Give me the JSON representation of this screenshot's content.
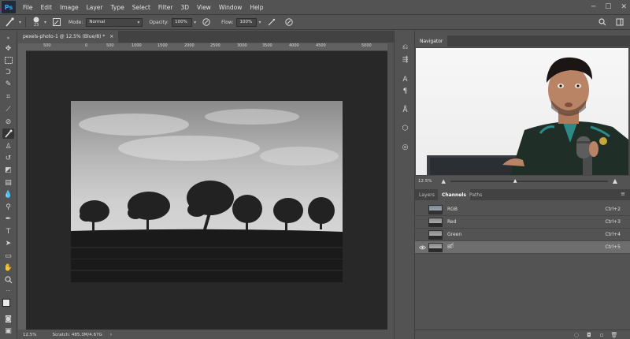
{
  "app": {
    "logo": "Ps"
  },
  "menu": [
    "File",
    "Edit",
    "Image",
    "Layer",
    "Type",
    "Select",
    "Filter",
    "3D",
    "View",
    "Window",
    "Help"
  ],
  "options": {
    "brush_size": "23",
    "mode_label": "Mode:",
    "mode_value": "Normal",
    "opacity_label": "Opacity:",
    "opacity_value": "100%",
    "flow_label": "Flow:",
    "flow_value": "100%"
  },
  "document": {
    "tab_title": "pexels-photo-1 @ 12.5% (Blue/8) *",
    "close": "×",
    "ruler_ticks": [
      "500",
      "0",
      "500",
      "1000",
      "1500",
      "2000",
      "2500",
      "3000",
      "3500",
      "4000",
      "4500",
      "5000"
    ],
    "zoom": "12.5%",
    "scratch": "Scratch: 485.3M/4.67G"
  },
  "navigator": {
    "tab": "Navigator",
    "zoom": "12.5%"
  },
  "panels": {
    "tabs": [
      "Layers",
      "Channels",
      "Paths"
    ],
    "active_tab": "Channels",
    "channels": [
      {
        "name": "RGB",
        "shortcut": "Ctrl+2",
        "visible": false
      },
      {
        "name": "Red",
        "shortcut": "Ctrl+3",
        "visible": false
      },
      {
        "name": "Green",
        "shortcut": "Ctrl+4",
        "visible": false
      },
      {
        "name": "Bl",
        "shortcut": "Ctrl+5",
        "visible": true
      }
    ]
  },
  "icons": {
    "eye": "eye-icon",
    "brush": "brush-icon",
    "zoom_in": "zoom-in-icon",
    "zoom_out": "zoom-out-icon"
  },
  "colors": {
    "accent": "#31a8ff",
    "panel_bg": "#535353",
    "canvas_bg": "#282828"
  }
}
